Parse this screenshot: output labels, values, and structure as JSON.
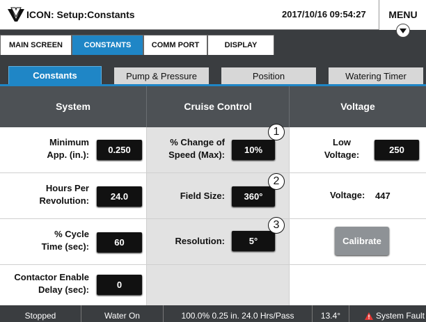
{
  "header": {
    "title": "ICON: Setup:Constants",
    "datetime": "2017/10/16 09:54:27",
    "menu_label": "MENU"
  },
  "topnav": {
    "tabs": [
      {
        "label": "MAIN SCREEN",
        "active": false
      },
      {
        "label": "CONSTANTS",
        "active": true
      },
      {
        "label": "COMM PORT",
        "active": false
      },
      {
        "label": "DISPLAY",
        "active": false
      }
    ]
  },
  "subtabs": {
    "tabs": [
      {
        "label": "Constants",
        "active": true
      },
      {
        "label": "Pump & Pressure",
        "active": false
      },
      {
        "label": "Position",
        "active": false
      },
      {
        "label": "Watering Timer",
        "active": false
      }
    ]
  },
  "columns": {
    "system": "System",
    "cruise": "Cruise Control",
    "voltage": "Voltage"
  },
  "system": {
    "min_app": {
      "label1": "Minimum",
      "label2": "App. (in.):",
      "value": "0.250"
    },
    "hours_rev": {
      "label1": "Hours Per",
      "label2": "Revolution:",
      "value": "24.0"
    },
    "cycle_time": {
      "label1": "% Cycle",
      "label2": "Time (sec):",
      "value": "60"
    },
    "contactor": {
      "label1": "Contactor Enable",
      "label2": "Delay (sec):",
      "value": "0"
    }
  },
  "cruise": {
    "speed_change": {
      "label1": "% Change of",
      "label2": "Speed (Max):",
      "value": "10%",
      "callout": "1"
    },
    "field_size": {
      "label": "Field Size:",
      "value": "360°",
      "callout": "2"
    },
    "resolution": {
      "label": "Resolution:",
      "value": "5°",
      "callout": "3"
    }
  },
  "voltage": {
    "low": {
      "label1": "Low",
      "label2": "Voltage:",
      "value": "250"
    },
    "reading_label": "Voltage:",
    "reading_value": "447",
    "calibrate_label": "Calibrate"
  },
  "status": {
    "state": "Stopped",
    "water": "Water On",
    "rate": "100.0%  0.25 in. 24.0 Hrs/Pass",
    "angle": "13.4°",
    "fault": "System Fault"
  },
  "colors": {
    "accent": "#1f86c6",
    "dark_bg": "#3a3d40",
    "warning": "#e53935"
  },
  "icons": {
    "logo": "valley-logo-icon",
    "menu": "chevron-down-icon",
    "fault": "warning-triangle-icon"
  }
}
